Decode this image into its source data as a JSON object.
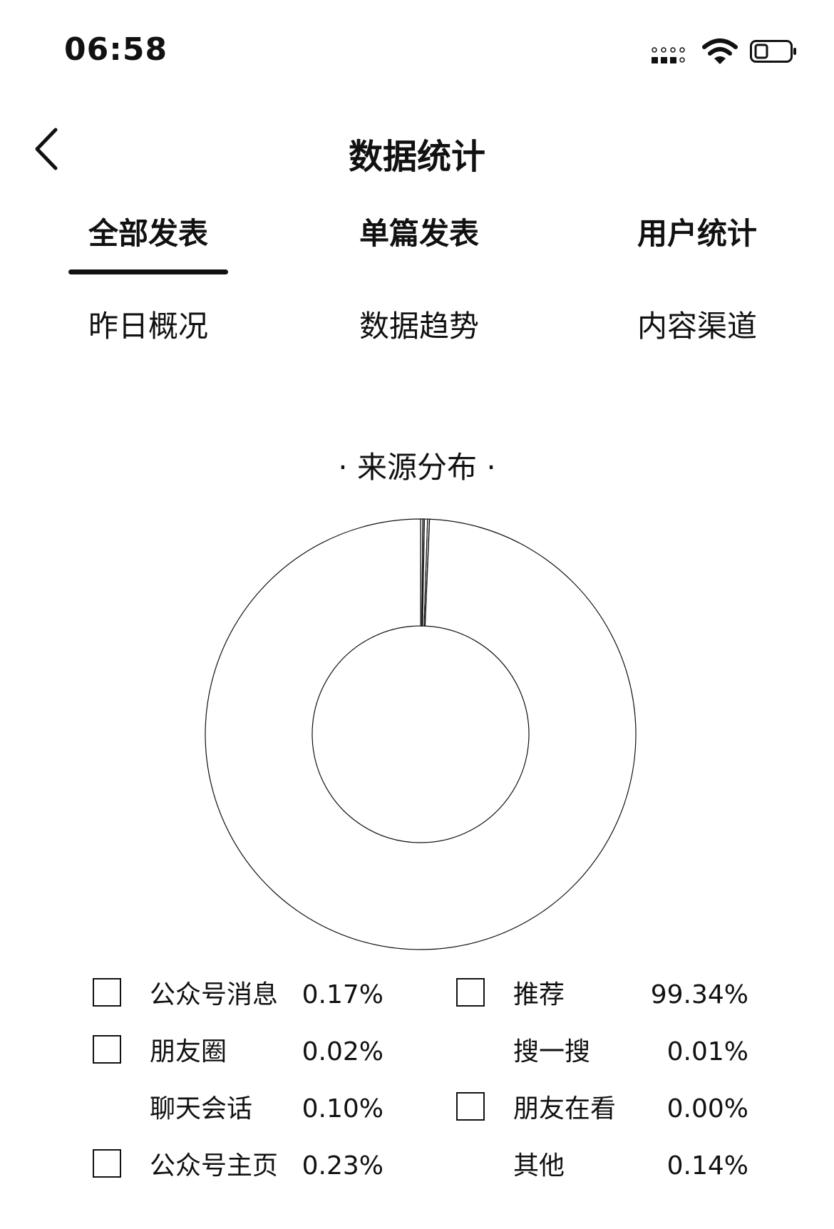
{
  "status_bar": {
    "time": "06:58"
  },
  "header": {
    "title": "数据统计"
  },
  "tabs": [
    {
      "label": "全部发表",
      "active": true
    },
    {
      "label": "单篇发表",
      "active": false
    },
    {
      "label": "用户统计",
      "active": false
    }
  ],
  "subtabs": [
    {
      "label": "昨日概况"
    },
    {
      "label": "数据趋势"
    },
    {
      "label": "内容渠道"
    }
  ],
  "chart_data": {
    "type": "pie",
    "title": "· 来源分布 ·",
    "slices": [
      {
        "name": "公众号消息",
        "value": 0.17,
        "label": "0.17%"
      },
      {
        "name": "推荐",
        "value": 99.34,
        "label": "99.34%"
      },
      {
        "name": "朋友圈",
        "value": 0.02,
        "label": "0.02%"
      },
      {
        "name": "搜一搜",
        "value": 0.01,
        "label": "0.01%"
      },
      {
        "name": "聊天会话",
        "value": 0.1,
        "label": "0.10%"
      },
      {
        "name": "朋友在看",
        "value": 0.0,
        "label": "0.00%"
      },
      {
        "name": "公众号主页",
        "value": 0.23,
        "label": "0.23%"
      },
      {
        "name": "其他",
        "value": 0.14,
        "label": "0.14%"
      }
    ]
  }
}
